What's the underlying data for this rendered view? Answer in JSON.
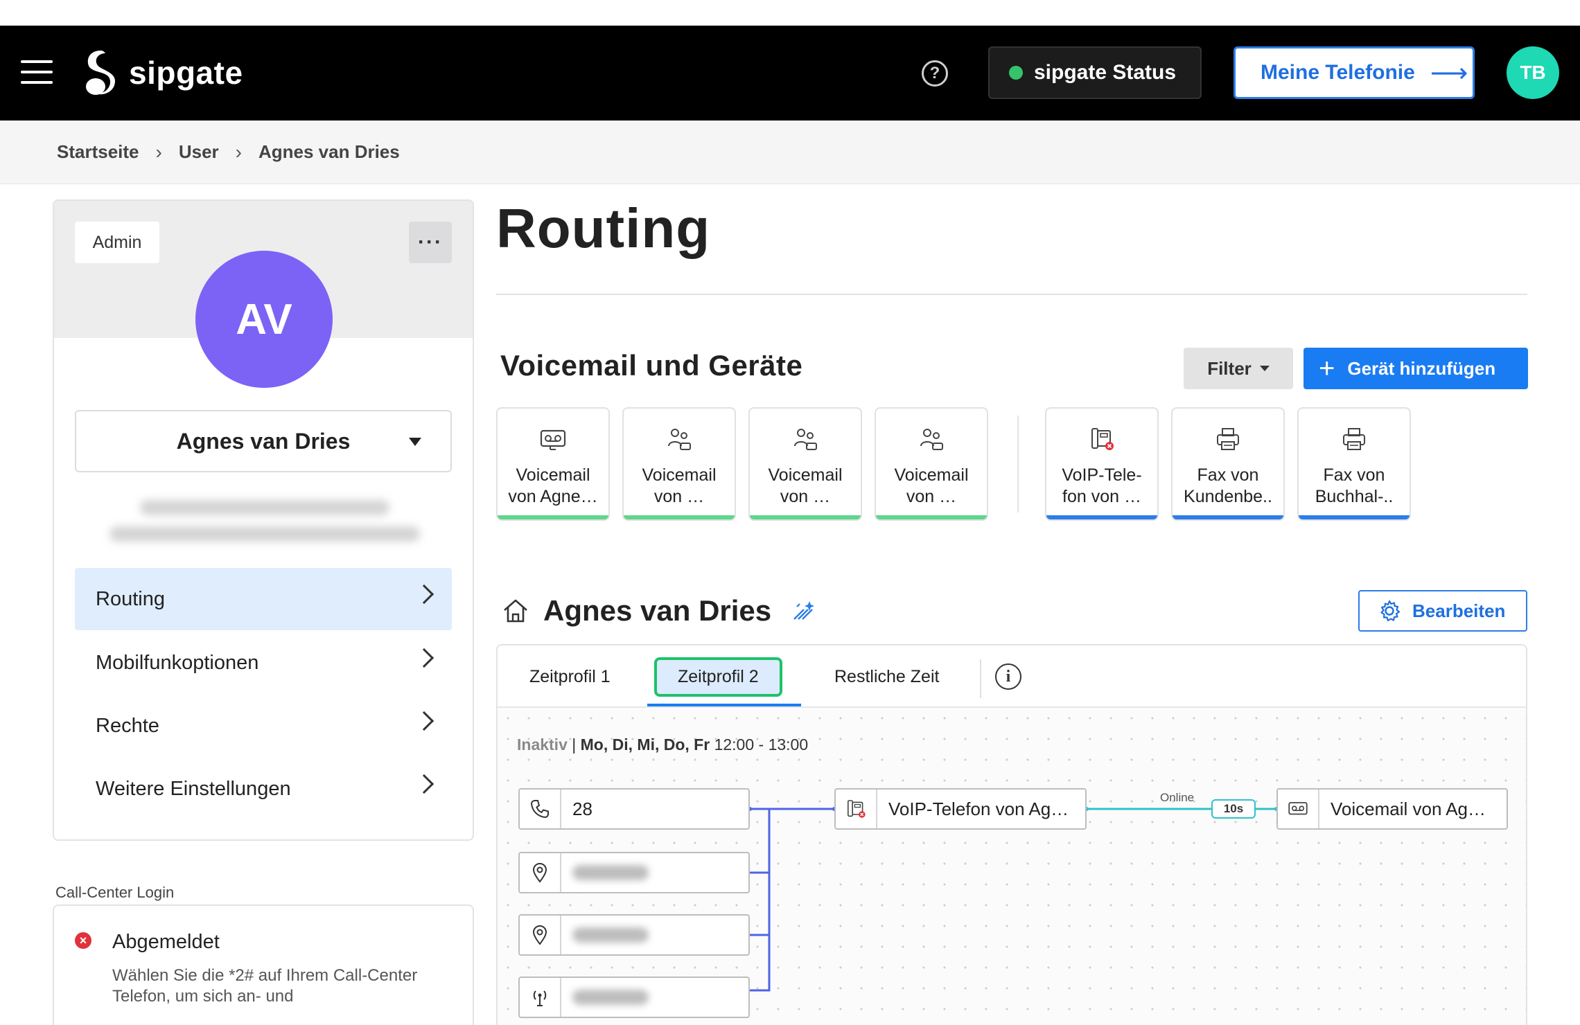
{
  "header": {
    "brand": "sipgate",
    "status_label": "sipgate Status",
    "telefonie_label": "Meine Telefonie",
    "user_initials": "TB",
    "colors": {
      "bar": "#000000",
      "status_dot": "#35c46a",
      "accent": "#1a7cf2",
      "avatar": "#1fd8b4"
    }
  },
  "breadcrumb": {
    "items": [
      "Startseite",
      "User",
      "Agnes van Dries"
    ]
  },
  "user_card": {
    "role_badge": "Admin",
    "initials": "AV",
    "selected_user": "Agnes van Dries",
    "avatar_color": "#7c63f5",
    "nav": [
      {
        "label": "Routing",
        "active": true
      },
      {
        "label": "Mobilfunkoptionen",
        "active": false
      },
      {
        "label": "Rechte",
        "active": false
      },
      {
        "label": "Weitere Einstellungen",
        "active": false
      }
    ]
  },
  "call_center": {
    "section_label": "Call-Center Login",
    "status": "Abgemeldet",
    "hint": "Wählen Sie die *2# auf Ihrem Call-Center Telefon, um sich an- und"
  },
  "main": {
    "title": "Routing",
    "devices_title": "Voicemail und Geräte",
    "filter_label": "Filter",
    "add_device_label": "Gerät hinzufügen",
    "devices": [
      {
        "line1": "Voicemail",
        "line2": "von Agne…",
        "icon": "voicemail-icon",
        "bar_color": "#5fd68b"
      },
      {
        "line1": "Voicemail",
        "line2": "von …",
        "icon": "group-voicemail-icon",
        "bar_color": "#5fd68b"
      },
      {
        "line1": "Voicemail",
        "line2": "von …",
        "icon": "group-voicemail-icon",
        "bar_color": "#5fd68b"
      },
      {
        "line1": "Voicemail",
        "line2": "von …",
        "icon": "group-voicemail-icon",
        "bar_color": "#5fd68b"
      },
      {
        "line1": "VoIP-Tele-",
        "line2": "fon von …",
        "icon": "voip-phone-offline-icon",
        "bar_color": "#2b7de9"
      },
      {
        "line1": "Fax von",
        "line2": "Kundenbe..",
        "icon": "fax-icon",
        "bar_color": "#2b7de9"
      },
      {
        "line1": "Fax von",
        "line2": "Buchhal-..",
        "icon": "fax-icon",
        "bar_color": "#2b7de9"
      }
    ],
    "profile_name": "Agnes van Dries",
    "edit_label": "Bearbeiten",
    "tabs": [
      {
        "label": "Zeitprofil 1",
        "active": false
      },
      {
        "label": "Zeitprofil 2",
        "active": true
      },
      {
        "label": "Restliche Zeit",
        "active": false
      }
    ],
    "schedule": {
      "state": "Inaktiv",
      "days": "Mo, Di, Mi, Do, Fr",
      "time": "12:00 - 13:00"
    },
    "flow": {
      "source_number": "28",
      "target_device": "VoIP-Telefon von Ag…",
      "connection_label": "Online",
      "delay": "10s",
      "fallback": "Voicemail von Ag…"
    }
  }
}
